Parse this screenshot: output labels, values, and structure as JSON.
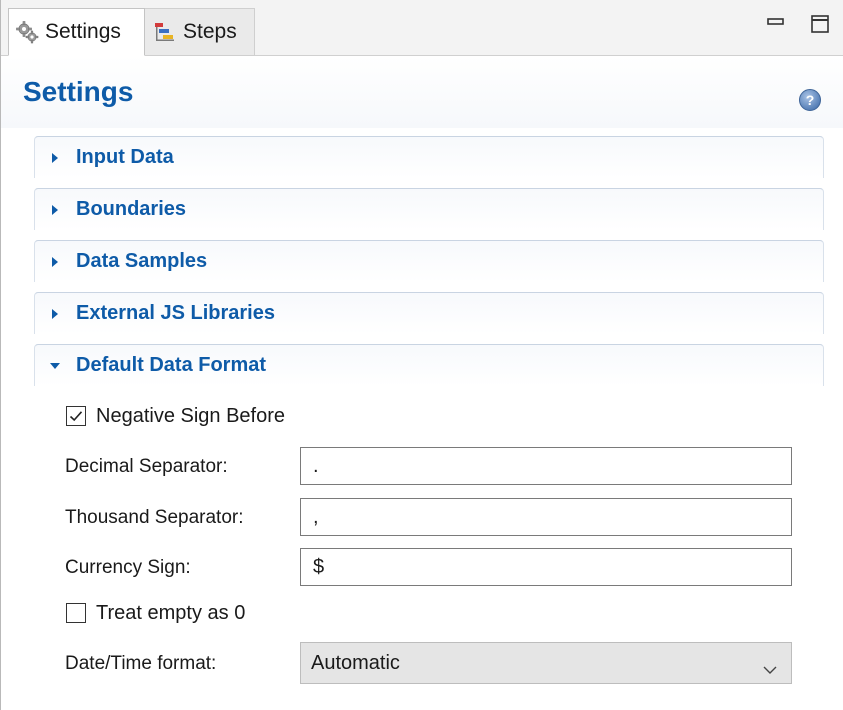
{
  "tabs": [
    {
      "label": "Settings",
      "icon": "gear-icon",
      "active": true
    },
    {
      "label": "Steps",
      "icon": "steps-icon",
      "active": false
    }
  ],
  "window_controls": {
    "minimize_icon": "minimize-icon",
    "maximize_icon": "maximize-icon"
  },
  "header": {
    "title": "Settings",
    "help_icon": "help-icon"
  },
  "sections": [
    {
      "label": "Input Data",
      "expanded": false
    },
    {
      "label": "Boundaries",
      "expanded": false
    },
    {
      "label": "Data Samples",
      "expanded": false
    },
    {
      "label": "External JS Libraries",
      "expanded": false
    },
    {
      "label": "Default Data Format",
      "expanded": true
    }
  ],
  "form": {
    "negative_sign_before": {
      "label": "Negative Sign Before",
      "checked": true
    },
    "decimal_separator": {
      "label": "Decimal Separator:",
      "value": "."
    },
    "thousand_separator": {
      "label": "Thousand Separator:",
      "value": ","
    },
    "currency_sign": {
      "label": "Currency Sign:",
      "value": "$"
    },
    "treat_empty_as_zero": {
      "label": "Treat empty as 0",
      "checked": false
    },
    "date_time_format": {
      "label": "Date/Time format:",
      "value": "Automatic"
    }
  },
  "colors": {
    "accent": "#0e5ba8",
    "section_border": "#c9d4e2",
    "select_bg": "#e5e5e5"
  }
}
